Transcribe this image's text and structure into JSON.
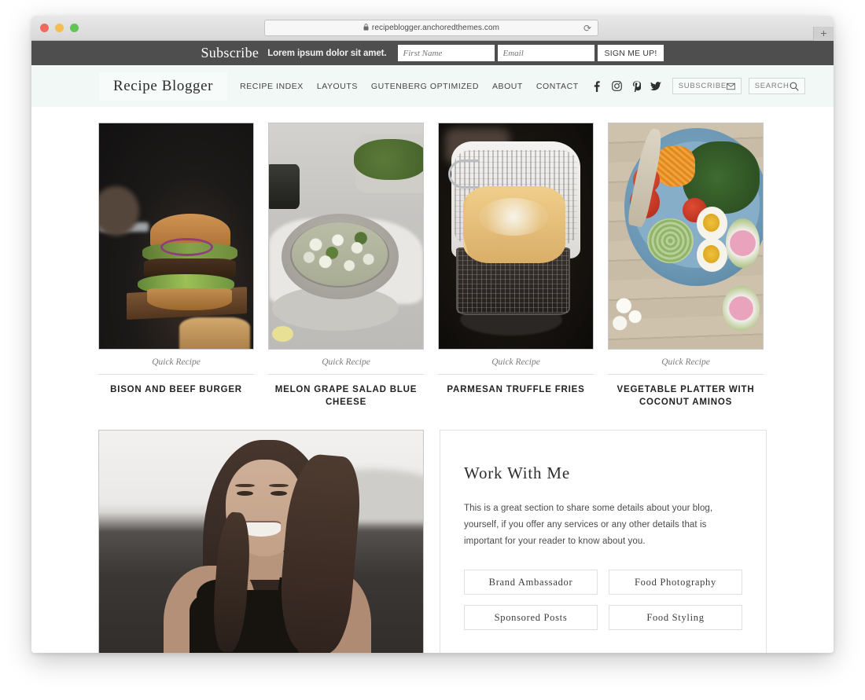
{
  "browser": {
    "url": "recipeblogger.anchoredthemes.com",
    "lock_icon": "lock-icon",
    "reload_icon": "reload-icon",
    "new_tab_label": "+",
    "traffic_lights": [
      "close",
      "minimize",
      "zoom"
    ]
  },
  "subscribe_bar": {
    "heading": "Subscribe",
    "tagline": "Lorem ipsum dolor sit amet.",
    "first_name_placeholder": "First Name",
    "email_placeholder": "Email",
    "button_label": "SIGN ME UP!",
    "background_color": "#4e4e4e"
  },
  "nav": {
    "logo": "Recipe Blogger",
    "background_color": "#f2f8f5",
    "links": [
      {
        "label": "RECIPE INDEX"
      },
      {
        "label": "LAYOUTS"
      },
      {
        "label": "GUTENBERG OPTIMIZED"
      },
      {
        "label": "ABOUT"
      },
      {
        "label": "CONTACT"
      }
    ],
    "socials": [
      {
        "name": "facebook-icon",
        "glyph": "f"
      },
      {
        "name": "instagram-icon",
        "glyph": "◎"
      },
      {
        "name": "pinterest-icon",
        "glyph": "P"
      },
      {
        "name": "twitter-icon",
        "glyph": "ᴠ"
      }
    ],
    "subscribe_box": {
      "label": "SUBSCRIBE",
      "icon": "envelope-icon"
    },
    "search_box": {
      "label": "SEARCH",
      "icon": "search-icon"
    }
  },
  "cards": [
    {
      "category": "Quick Recipe",
      "title": "BISON AND BEEF BURGER",
      "image_alt": "burger-photo"
    },
    {
      "category": "Quick Recipe",
      "title": "MELON GRAPE SALAD BLUE CHEESE",
      "image_alt": "salad-photo"
    },
    {
      "category": "Quick Recipe",
      "title": "PARMESAN TRUFFLE FRIES",
      "image_alt": "fries-photo"
    },
    {
      "category": "Quick Recipe",
      "title": "VEGETABLE PLATTER WITH COCONUT AMINOS",
      "image_alt": "vegetable-platter-photo"
    }
  ],
  "portrait": {
    "image_alt": "author-portrait-photo"
  },
  "work_with_me": {
    "title": "Work With Me",
    "body": "This is a great section to share some details about your blog, yourself, if you offer any services or any other details that is important for your reader to know about you.",
    "buttons": [
      {
        "label": "Brand Ambassador"
      },
      {
        "label": "Food Photography"
      },
      {
        "label": "Sponsored Posts"
      },
      {
        "label": "Food Styling"
      }
    ]
  }
}
